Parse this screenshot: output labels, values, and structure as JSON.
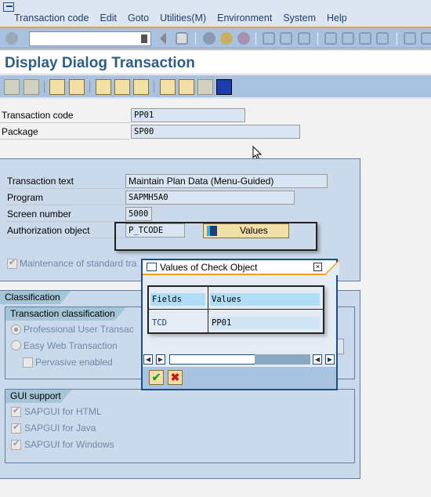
{
  "menubar": {
    "items": [
      "Transaction code",
      "Edit",
      "Goto",
      "Utilities(M)",
      "Environment",
      "System",
      "Help"
    ]
  },
  "system_toolbar": {
    "command_field": {
      "value": "",
      "placeholder": ""
    },
    "icons": [
      "enter-icon",
      "back-icon",
      "save-icon",
      "back-nav-icon",
      "exit-icon",
      "cancel-icon",
      "print-icon",
      "find-icon",
      "find-next-icon",
      "first-page-icon",
      "previous-page-icon",
      "next-page-icon",
      "last-page-icon",
      "new-session-icon",
      "shortcut-icon"
    ]
  },
  "header": {
    "title": "Display Dialog Transaction"
  },
  "app_toolbar": {
    "icons": [
      "back-arrow-icon",
      "forward-arrow-icon",
      "display-change-icon",
      "other-object-icon",
      "where-used-icon",
      "display-object-list-icon",
      "navigation-icon",
      "hierarchy-icon",
      "structure-icon",
      "layout-icon",
      "info-icon"
    ]
  },
  "fields": {
    "transaction_code": {
      "label": "Transaction code",
      "value": "PP01"
    },
    "package": {
      "label": "Package",
      "value": "SP00"
    }
  },
  "details": {
    "transaction_text": {
      "label": "Transaction text",
      "value": "Maintain Plan Data (Menu-Guided)"
    },
    "program": {
      "label": "Program",
      "value": "SAPMH5A0"
    },
    "screen_number": {
      "label": "Screen number",
      "value": "5000"
    },
    "authorization_object": {
      "label": "Authorization object",
      "value": "P_TCODE"
    },
    "values_button": "Values",
    "maintenance_checkbox": {
      "label": "Maintenance of standard tra",
      "checked": true
    }
  },
  "classification": {
    "title": "Classification",
    "transaction_classification": {
      "title": "Transaction classification",
      "professional": {
        "label": "Professional User Transac",
        "selected": true
      },
      "easy_web": {
        "label": "Easy Web Transaction",
        "selected": false
      },
      "pervasive": {
        "label": "Pervasive enabled",
        "checked": false
      }
    },
    "gui_support": {
      "title": "GUI support",
      "items": [
        {
          "label": "SAPGUI for HTML",
          "checked": true
        },
        {
          "label": "SAPGUI for Java",
          "checked": true
        },
        {
          "label": "SAPGUI for Windows",
          "checked": true
        }
      ]
    }
  },
  "popup": {
    "title": "Values of Check Object",
    "columns": [
      "Fields",
      "Values"
    ],
    "rows": [
      {
        "field": "TCD",
        "value": "PP01"
      }
    ],
    "confirm_label": "✔",
    "cancel_label": "✖"
  }
}
